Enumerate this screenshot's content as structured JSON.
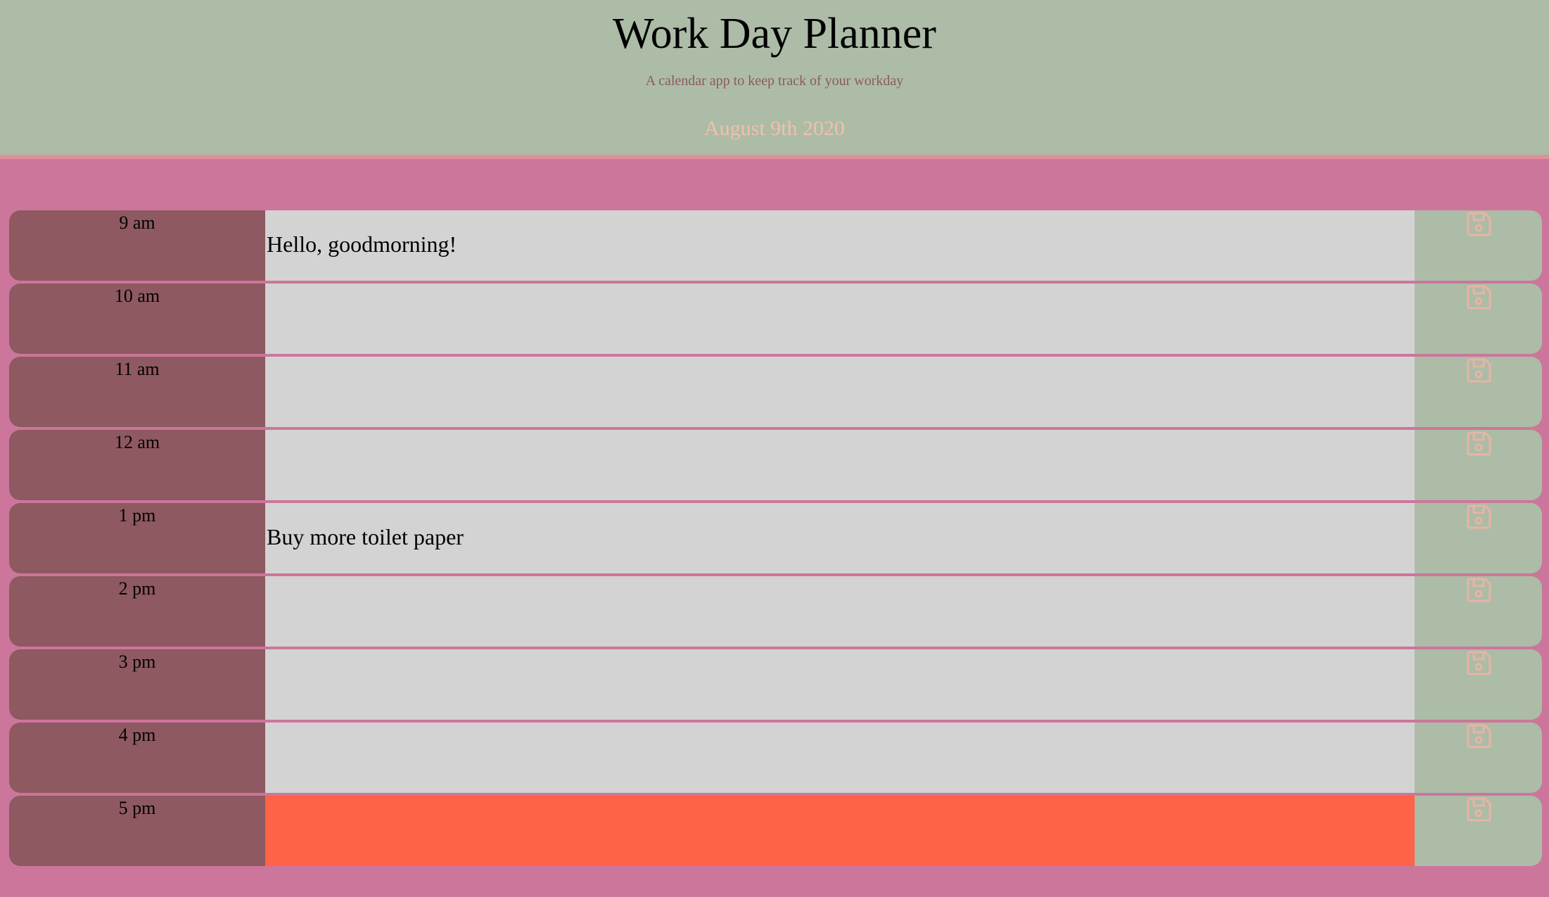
{
  "header": {
    "title": "Work Day Planner",
    "subtitle": "A calendar app to keep track of your workday",
    "date": "August 9th 2020"
  },
  "colors": {
    "background": "#cc769b",
    "header": "#acbca7",
    "hour_block": "#8e5960",
    "past_future": "#d3d3d3",
    "present": "#ff6347",
    "save_button": "#acbca7",
    "save_icon": "#e7b4a4"
  },
  "save_icon": "floppy-disk-icon",
  "timeblocks": [
    {
      "hour": "9 am",
      "task": "Hello, goodmorning!",
      "state": "gray"
    },
    {
      "hour": "10 am",
      "task": "",
      "state": "gray"
    },
    {
      "hour": "11 am",
      "task": "",
      "state": "gray"
    },
    {
      "hour": "12 am",
      "task": "",
      "state": "gray"
    },
    {
      "hour": "1 pm",
      "task": "Buy more toilet paper",
      "state": "gray"
    },
    {
      "hour": "2 pm",
      "task": "",
      "state": "gray"
    },
    {
      "hour": "3 pm",
      "task": "",
      "state": "gray"
    },
    {
      "hour": "4 pm",
      "task": "",
      "state": "gray"
    },
    {
      "hour": "5 pm",
      "task": "",
      "state": "present"
    }
  ]
}
